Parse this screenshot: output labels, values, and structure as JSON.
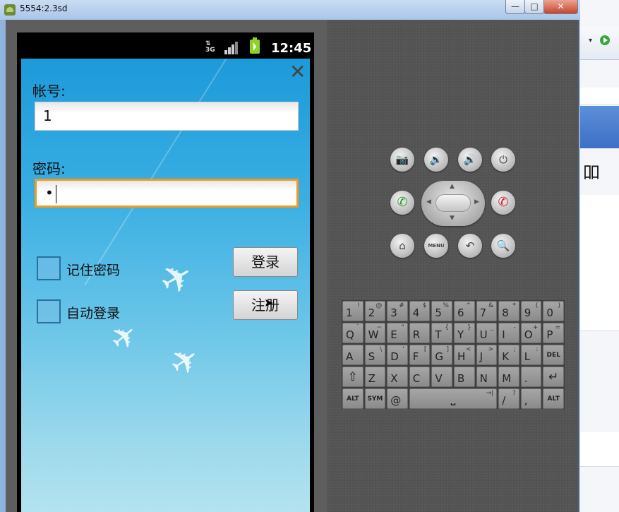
{
  "window": {
    "title": "5554:2.3sd",
    "minimize_label": "—",
    "maximize_label": "□",
    "close_label": "✕"
  },
  "background_ide": {
    "partial_glyph": "吅"
  },
  "status_bar": {
    "network": "3G",
    "time": "12:45"
  },
  "login": {
    "account_label": "帐号:",
    "account_value": "1",
    "password_label": "密码:",
    "password_value": "•",
    "remember_label": "记住密码",
    "auto_login_label": "自动登录",
    "login_button": "登录",
    "register_button": "注册",
    "close_glyph": "✕"
  },
  "hardware": {
    "camera": "📷",
    "vol_down": "🔉",
    "vol_up": "🔊",
    "power": "⏻",
    "call": "✆",
    "end_call": "✆",
    "home": "⌂",
    "menu": "MENU",
    "back": "↶",
    "search": "🔍"
  },
  "keyboard": {
    "row1": [
      {
        "main": "1",
        "sub": "!"
      },
      {
        "main": "2",
        "sub": "@"
      },
      {
        "main": "3",
        "sub": "#"
      },
      {
        "main": "4",
        "sub": "$"
      },
      {
        "main": "5",
        "sub": "%"
      },
      {
        "main": "6",
        "sub": "^"
      },
      {
        "main": "7",
        "sub": "&"
      },
      {
        "main": "8",
        "sub": "*"
      },
      {
        "main": "9",
        "sub": "("
      },
      {
        "main": "0",
        "sub": ")"
      }
    ],
    "row2": [
      {
        "main": "Q",
        "sub": "`"
      },
      {
        "main": "W",
        "sub": "~"
      },
      {
        "main": "E",
        "sub": "\""
      },
      {
        "main": "R",
        "sub": ""
      },
      {
        "main": "T",
        "sub": "{"
      },
      {
        "main": "Y",
        "sub": "}"
      },
      {
        "main": "U",
        "sub": "_"
      },
      {
        "main": "I",
        "sub": "-"
      },
      {
        "main": "O",
        "sub": "+"
      },
      {
        "main": "P",
        "sub": "="
      }
    ],
    "row3": [
      {
        "main": "A",
        "sub": ""
      },
      {
        "main": "S",
        "sub": "\\"
      },
      {
        "main": "D",
        "sub": "'"
      },
      {
        "main": "F",
        "sub": "["
      },
      {
        "main": "G",
        "sub": "]"
      },
      {
        "main": "H",
        "sub": "<"
      },
      {
        "main": "J",
        "sub": ">"
      },
      {
        "main": "K",
        "sub": ";"
      },
      {
        "main": "L",
        "sub": ":"
      },
      {
        "main": "DEL",
        "sub": ""
      }
    ],
    "row4": [
      {
        "main": "⇧",
        "sub": ""
      },
      {
        "main": "Z",
        "sub": ""
      },
      {
        "main": "X",
        "sub": ""
      },
      {
        "main": "C",
        "sub": ""
      },
      {
        "main": "V",
        "sub": ""
      },
      {
        "main": "B",
        "sub": ""
      },
      {
        "main": "N",
        "sub": ""
      },
      {
        "main": "M",
        "sub": ""
      },
      {
        "main": ".",
        "sub": ""
      },
      {
        "main": "↵",
        "sub": ""
      }
    ],
    "row5": [
      {
        "main": "ALT",
        "sub": ""
      },
      {
        "main": "SYM",
        "sub": ""
      },
      {
        "main": "@",
        "sub": ""
      },
      {
        "main": "⎵",
        "sub": "→|"
      },
      {
        "main": "/",
        "sub": "?"
      },
      {
        "main": ",",
        "sub": ""
      },
      {
        "main": "ALT",
        "sub": ""
      }
    ]
  }
}
